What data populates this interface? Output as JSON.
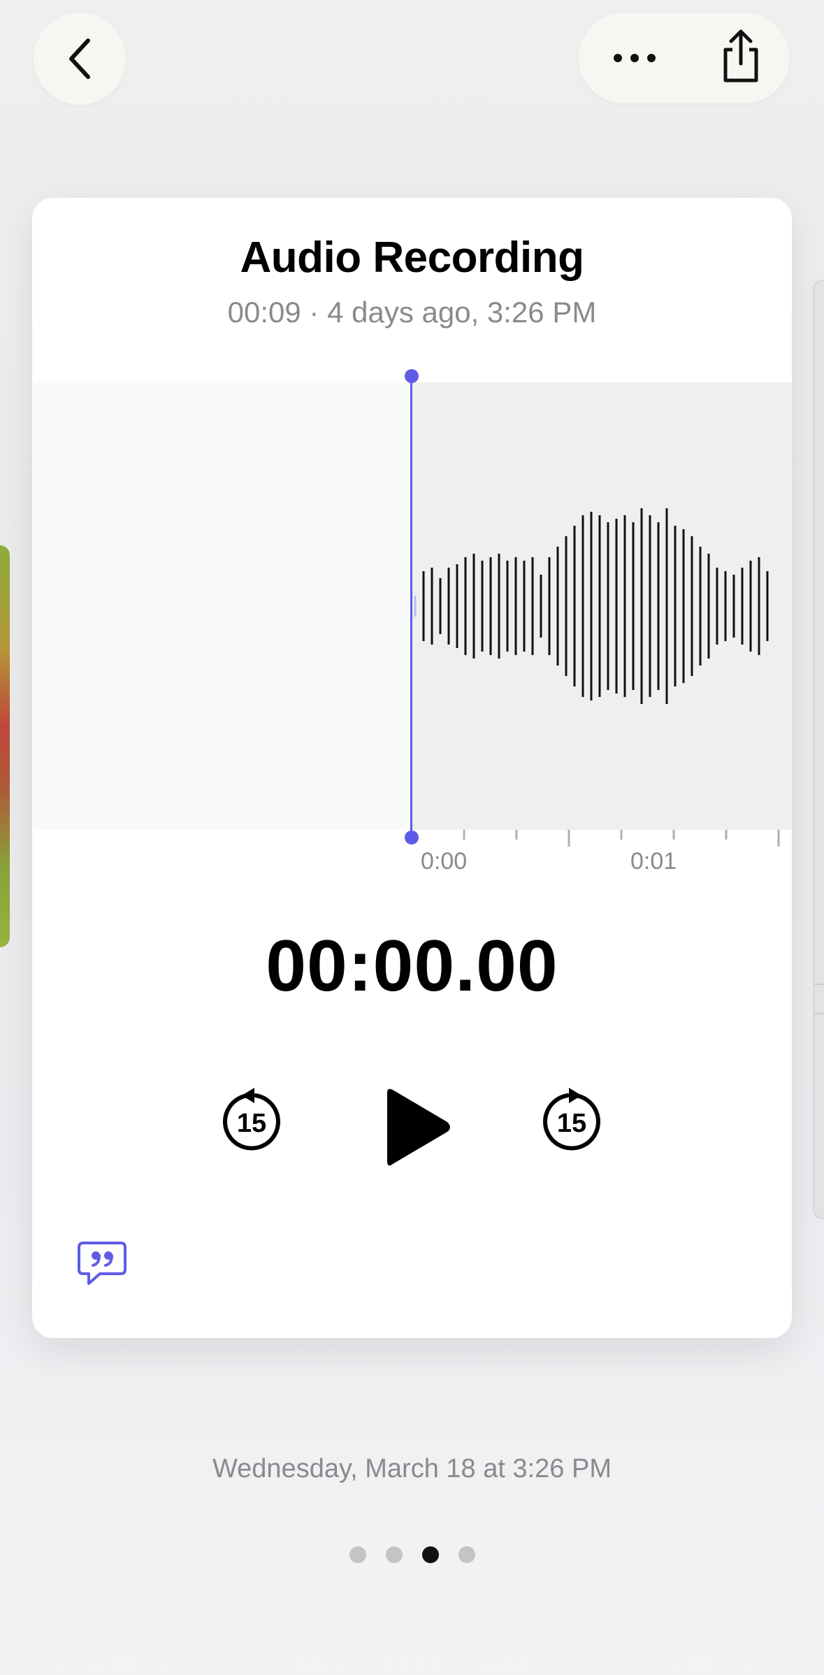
{
  "navigation": {
    "back_icon": "chevron-left-icon",
    "more_icon": "ellipsis-icon",
    "share_icon": "share-icon"
  },
  "recording": {
    "title": "Audio Recording",
    "subtitle": "00:09 · 4 days ago, 3:26 PM",
    "current_time": "00:00.00",
    "progress": 0
  },
  "timeline": {
    "tick_labels": [
      "0:00",
      "0:01"
    ]
  },
  "controls": {
    "skip_back_label": "15",
    "skip_forward_label": "15",
    "play_icon": "play-icon",
    "transcript_icon": "transcript-quote-icon"
  },
  "footer": {
    "date": "Wednesday, March 18 at 3:26 PM",
    "page_count": 4,
    "active_page": 3
  },
  "colors": {
    "accent": "#5e5ce6",
    "waveform": "#111111",
    "secondary_text": "#8a8a8e"
  }
}
